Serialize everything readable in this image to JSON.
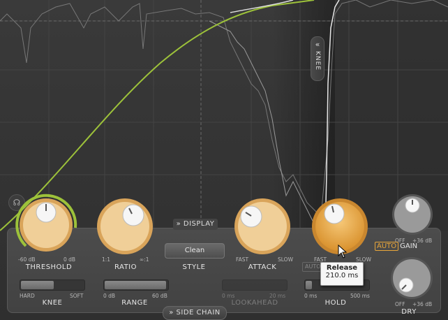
{
  "colors": {
    "knob_orange": "#e8a850",
    "knob_light": "#f3d29a",
    "curve_green": "#9dc23a",
    "accent_auto": "#e8a63a"
  },
  "graph": {
    "knee_tab_label": "KNEE"
  },
  "display_tab": "DISPLAY",
  "side_chain_tab": "SIDE CHAIN",
  "style": {
    "label": "STYLE",
    "button": "Clean"
  },
  "knobs": {
    "threshold": {
      "label": "THRESHOLD",
      "min": "-60 dB",
      "max": "0 dB"
    },
    "ratio": {
      "label": "RATIO",
      "min": "1:1",
      "max": "∞:1"
    },
    "attack": {
      "label": "ATTACK",
      "min": "FAST",
      "max": "SLOW"
    },
    "release": {
      "label": "RELEASE",
      "min": "FAST",
      "max": "SLOW"
    },
    "gain": {
      "label": "GAIN",
      "auto": "AUTO",
      "min": "OFF",
      "max": "+36 dB"
    },
    "dry": {
      "label": "DRY",
      "min": "OFF",
      "max": "+36 dB"
    }
  },
  "sliders": {
    "knee": {
      "label": "KNEE",
      "min": "HARD",
      "max": "SOFT",
      "value": 0.52
    },
    "range": {
      "label": "RANGE",
      "min": "0 dB",
      "max": "60 dB",
      "value": 0.98
    },
    "lookahead": {
      "label": "LOOKAHEAD",
      "min": "0 ms",
      "max": "20 ms",
      "value": 0.0
    },
    "hold": {
      "label": "HOLD",
      "min": "0 ms",
      "max": "500 ms",
      "value": 0.1
    }
  },
  "auto_release_label": "AUTO",
  "tooltip": {
    "title": "Release",
    "value": "210.0 ms"
  }
}
